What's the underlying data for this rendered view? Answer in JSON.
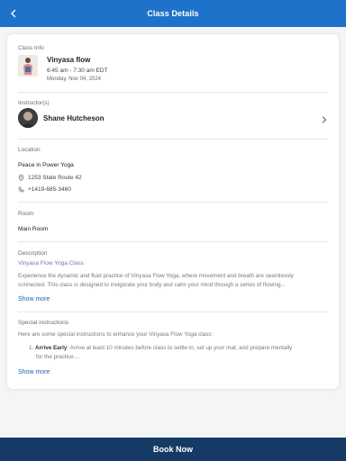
{
  "header": {
    "title": "Class Details",
    "back_icon": "chevron-left-icon"
  },
  "class_info": {
    "label": "Class Info",
    "name": "Vinyasa flow",
    "time": "6:45 am - 7:30 am EDT",
    "date": "Monday, Nov 04, 2024"
  },
  "instructors": {
    "label": "Instructor(s)",
    "name": "Shane Hutcheson",
    "chevron_icon": "chevron-right-icon"
  },
  "location": {
    "label": "Location",
    "name": "Peace in Power Yoga",
    "address": "1253 State Route 42",
    "phone": "+1419-685-3460",
    "address_icon": "map-pin-icon",
    "phone_icon": "phone-icon"
  },
  "room": {
    "label": "Room",
    "value": "Main Room"
  },
  "description": {
    "label": "Description",
    "title": "Vinyasa Flow Yoga Class",
    "line1": "Experience the dynamic and fluid practice of Vinyasa Flow Yoga, where movement and breath are seamlessly",
    "line2": "connected. This class is designed to invigorate your body and calm your mind through a series of flowing...",
    "show_more": "Show more"
  },
  "special_instructions": {
    "label": "Special instructions",
    "intro": "Here are some special instructions to enhance your Vinyasa Flow Yoga class:",
    "item_number": "1.",
    "item_title": "Arrive Early",
    "item_text_line1": ": Arrive at least 10 minutes before class to settle in, set up your mat, and prepare mentally",
    "item_text_line2": "for the practice....",
    "show_more": "Show more"
  },
  "footer": {
    "book_label": "Book Now"
  },
  "colors": {
    "header": "#1f72c9",
    "footer": "#153a66",
    "link": "#1f5fbf"
  }
}
